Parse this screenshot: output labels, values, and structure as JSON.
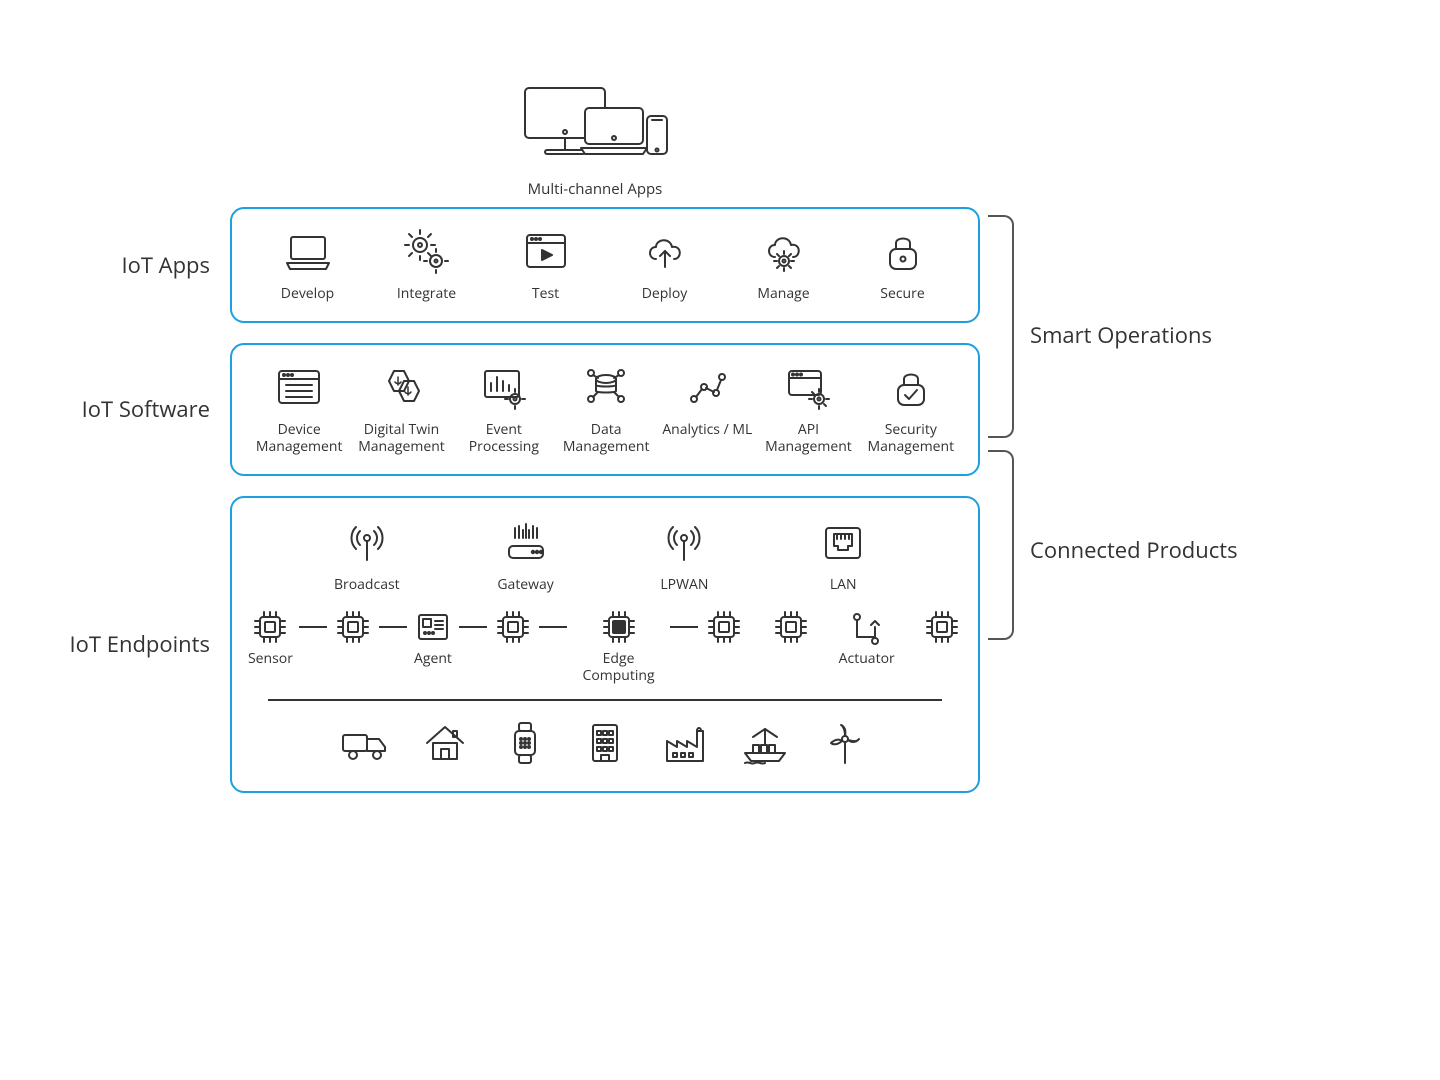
{
  "top": {
    "label": "Multi-channel Apps"
  },
  "layers": {
    "apps": {
      "title": "IoT Apps",
      "items": [
        "Develop",
        "Integrate",
        "Test",
        "Deploy",
        "Manage",
        "Secure"
      ]
    },
    "software": {
      "title": "IoT Software",
      "items": [
        "Device Management",
        "Digital Twin Management",
        "Event Processing",
        "Data Management",
        "Analytics / ML",
        "API Management",
        "Security Management"
      ]
    },
    "endpoints": {
      "title": "IoT Endpoints",
      "network": [
        "Broadcast",
        "Gateway",
        "LPWAN",
        "LAN"
      ],
      "chips": [
        "Sensor",
        "Agent",
        "Edge Computing",
        "Actuator"
      ]
    }
  },
  "side": {
    "smart": "Smart Operations",
    "connected": "Connected Products"
  }
}
